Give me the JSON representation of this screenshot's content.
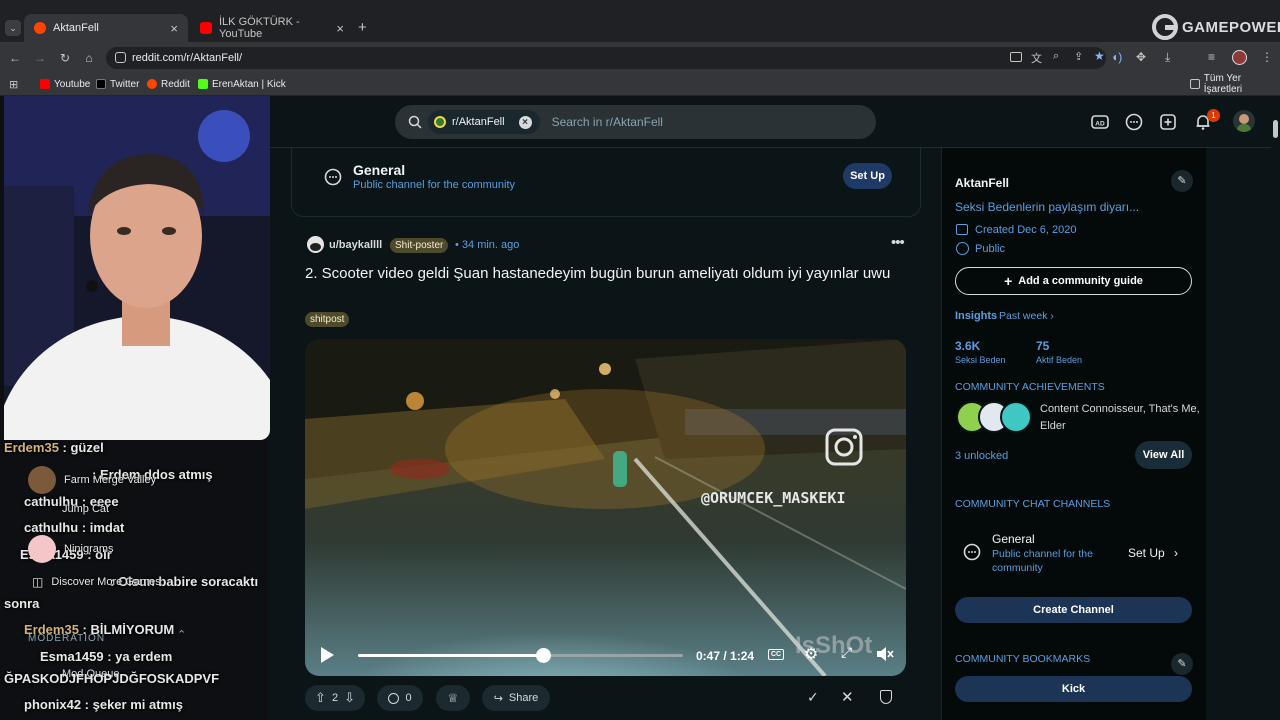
{
  "browser": {
    "tabs": [
      {
        "label": "AktanFell",
        "active": true
      },
      {
        "label": "İLK GÖKTÜRK - YouTube",
        "active": false
      }
    ],
    "new_tab": "+",
    "url": "reddit.com/r/AktanFell/",
    "bookmarks": [
      "Youtube",
      "Twitter",
      "Reddit",
      "ErenAktan | Kick"
    ],
    "all_bookmarks": "Tüm Yer İşaretleri",
    "notification_count": "1"
  },
  "watermark": "GAMEPOWER",
  "reddit": {
    "search_chip": "r/AktanFell",
    "search_placeholder": "Search in r/AktanFell",
    "general_channel": {
      "title": "General",
      "subtitle": "Public channel for the community",
      "button": "Set Up"
    },
    "post": {
      "author": "u/baykallll",
      "user_flair": "Shit-poster",
      "time": "• 34 min. ago",
      "title": "2. Scooter video geldi Şuan hastanedeyim bugün burun ameliyatı oldum iyi yayınlar uwu",
      "post_flair": "shitpost",
      "video_watermark": "@ORUMCEK_MASKEKI",
      "video_corner_text": "IsShOt",
      "time_display": "0:47 / 1:24",
      "progress": 0.57,
      "votes": "2",
      "comments": "0",
      "share": "Share"
    },
    "sidebar": {
      "name": "AktanFell",
      "description": "Seksi Bedenlerin paylaşım diyarı...",
      "created": "Created Dec 6, 2020",
      "visibility": "Public",
      "add_guide": "Add a community guide",
      "insights_label": "Insights",
      "insights_range": "Past week",
      "stat1_value": "3.6K",
      "stat1_label": "Seksi Beden",
      "stat2_value": "75",
      "stat2_label": "Aktif Beden",
      "achievements_header": "COMMUNITY ACHIEVEMENTS",
      "achievements_line1": "Content Connoisseur, That's Me,",
      "achievements_line2": "Elder",
      "unlocked": "3 unlocked",
      "view_all": "View All",
      "chat_header": "COMMUNITY CHAT CHANNELS",
      "chat_title": "General",
      "chat_sub1": "Public channel for the",
      "chat_sub2": "community",
      "chat_setup": "Set Up",
      "create_channel": "Create Channel",
      "bookmarks_header": "COMMUNITY BOOKMARKS",
      "bookmark_kick": "Kick"
    }
  },
  "stream_overlay": {
    "chat": [
      {
        "user": "Erdem35",
        "text": " : güzel"
      },
      {
        "user": "",
        "text": ": Erdem ddos atmış"
      },
      {
        "user": "",
        "text": "cathulhu : eeee"
      },
      {
        "user": "",
        "text": "cathulhu : imdat"
      },
      {
        "user": "",
        "text": "Esma1459 : olr"
      },
      {
        "user": "",
        "text": ": Olsun babire soracaktı"
      },
      {
        "user": "",
        "text": "sonra"
      },
      {
        "user": "Erdem35",
        "text": " : BİLMİYORUM"
      },
      {
        "user": "",
        "text": "Esma1459 : ya erdem"
      },
      {
        "user": "",
        "text": "ĞPASKODJFHOPJDĞFOSKADPVF"
      },
      {
        "user": "",
        "text": "phonix42 : şeker mi atmış"
      }
    ],
    "games": [
      "Farm Merge Valley",
      "Jump Cat",
      "Ninigrams",
      "Discover More Games"
    ],
    "moderation_label": "MODERATION",
    "mod_queue": "Mod Queue"
  }
}
